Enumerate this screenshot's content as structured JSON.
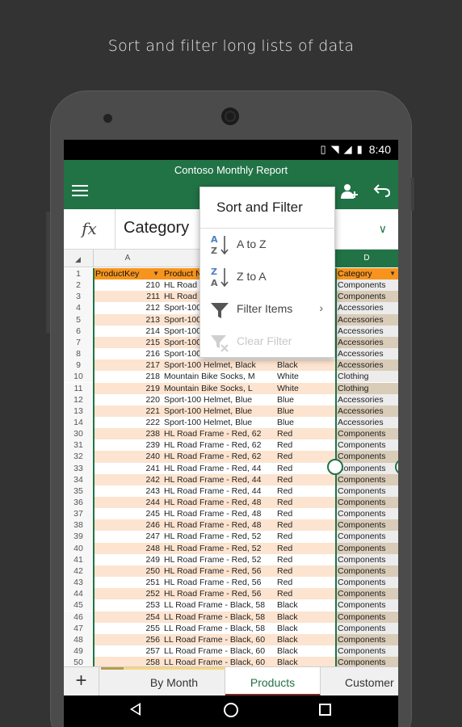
{
  "caption": "Sort and filter long lists of data",
  "status_bar": {
    "time": "8:40"
  },
  "app": {
    "doc_title": "Contoso Monthly Report"
  },
  "formula_bar": {
    "fx": "fx",
    "value": "Category"
  },
  "columns": {
    "a": "A",
    "d": "D"
  },
  "header_row": {
    "num": "1",
    "a": "ProductKey",
    "b": "Product N",
    "c": "",
    "d": "Category"
  },
  "rows": [
    {
      "num": "2",
      "a": "210",
      "b": "HL Road",
      "c": "",
      "d": "Components"
    },
    {
      "num": "3",
      "a": "211",
      "b": "HL Road",
      "c": "",
      "d": "Components"
    },
    {
      "num": "4",
      "a": "212",
      "b": "Sport-100",
      "c": "",
      "d": "Accessories"
    },
    {
      "num": "5",
      "a": "213",
      "b": "Sport-100",
      "c": "",
      "d": "Accessories"
    },
    {
      "num": "6",
      "a": "214",
      "b": "Sport-100",
      "c": "",
      "d": "Accessories"
    },
    {
      "num": "7",
      "a": "215",
      "b": "Sport-100",
      "c": "",
      "d": "Accessories"
    },
    {
      "num": "8",
      "a": "216",
      "b": "Sport-100",
      "c": "",
      "d": "Accessories"
    },
    {
      "num": "9",
      "a": "217",
      "b": "Sport-100 Helmet, Black",
      "c": "Black",
      "d": "Accessories"
    },
    {
      "num": "10",
      "a": "218",
      "b": "Mountain Bike Socks, M",
      "c": "White",
      "d": "Clothing"
    },
    {
      "num": "11",
      "a": "219",
      "b": "Mountain Bike Socks, L",
      "c": "White",
      "d": "Clothing"
    },
    {
      "num": "12",
      "a": "220",
      "b": "Sport-100 Helmet, Blue",
      "c": "Blue",
      "d": "Accessories"
    },
    {
      "num": "13",
      "a": "221",
      "b": "Sport-100 Helmet, Blue",
      "c": "Blue",
      "d": "Accessories"
    },
    {
      "num": "14",
      "a": "222",
      "b": "Sport-100 Helmet, Blue",
      "c": "Blue",
      "d": "Accessories"
    },
    {
      "num": "30",
      "a": "238",
      "b": "HL Road Frame - Red, 62",
      "c": "Red",
      "d": "Components"
    },
    {
      "num": "31",
      "a": "239",
      "b": "HL Road Frame - Red, 62",
      "c": "Red",
      "d": "Components"
    },
    {
      "num": "32",
      "a": "240",
      "b": "HL Road Frame - Red, 62",
      "c": "Red",
      "d": "Components"
    },
    {
      "num": "33",
      "a": "241",
      "b": "HL Road Frame - Red, 44",
      "c": "Red",
      "d": "Components"
    },
    {
      "num": "34",
      "a": "242",
      "b": "HL Road Frame - Red, 44",
      "c": "Red",
      "d": "Components"
    },
    {
      "num": "35",
      "a": "243",
      "b": "HL Road Frame - Red, 44",
      "c": "Red",
      "d": "Components"
    },
    {
      "num": "36",
      "a": "244",
      "b": "HL Road Frame - Red, 48",
      "c": "Red",
      "d": "Components"
    },
    {
      "num": "37",
      "a": "245",
      "b": "HL Road Frame - Red, 48",
      "c": "Red",
      "d": "Components"
    },
    {
      "num": "38",
      "a": "246",
      "b": "HL Road Frame - Red, 48",
      "c": "Red",
      "d": "Components"
    },
    {
      "num": "39",
      "a": "247",
      "b": "HL Road Frame - Red, 52",
      "c": "Red",
      "d": "Components"
    },
    {
      "num": "40",
      "a": "248",
      "b": "HL Road Frame - Red, 52",
      "c": "Red",
      "d": "Components"
    },
    {
      "num": "41",
      "a": "249",
      "b": "HL Road Frame - Red, 52",
      "c": "Red",
      "d": "Components"
    },
    {
      "num": "42",
      "a": "250",
      "b": "HL Road Frame - Red, 56",
      "c": "Red",
      "d": "Components"
    },
    {
      "num": "43",
      "a": "251",
      "b": "HL Road Frame - Red, 56",
      "c": "Red",
      "d": "Components"
    },
    {
      "num": "44",
      "a": "252",
      "b": "HL Road Frame - Red, 56",
      "c": "Red",
      "d": "Components"
    },
    {
      "num": "45",
      "a": "253",
      "b": "LL Road Frame - Black, 58",
      "c": "Black",
      "d": "Components"
    },
    {
      "num": "46",
      "a": "254",
      "b": "LL Road Frame - Black, 58",
      "c": "Black",
      "d": "Components"
    },
    {
      "num": "47",
      "a": "255",
      "b": "LL Road Frame - Black, 58",
      "c": "Black",
      "d": "Components"
    },
    {
      "num": "48",
      "a": "256",
      "b": "LL Road Frame - Black, 60",
      "c": "Black",
      "d": "Components"
    },
    {
      "num": "49",
      "a": "257",
      "b": "LL Road Frame - Black, 60",
      "c": "Black",
      "d": "Components"
    },
    {
      "num": "50",
      "a": "258",
      "b": "LL Road Frame - Black, 60",
      "c": "Black",
      "d": "Components"
    }
  ],
  "popup": {
    "title": "Sort and Filter",
    "items": [
      {
        "label": "A to Z",
        "icon": "sort-a-to-z-icon",
        "icon_text": "A Z"
      },
      {
        "label": "Z to A",
        "icon": "sort-z-to-a-icon",
        "icon_text": "Z A"
      },
      {
        "label": "Filter Items",
        "icon": "filter-icon",
        "icon_text": ""
      },
      {
        "label": "Clear Filter",
        "icon": "clear-filter-icon",
        "icon_text": ""
      }
    ]
  },
  "tabs": {
    "add": "+",
    "items": [
      "By Month",
      "Products",
      "Customer"
    ]
  },
  "colors": {
    "accent": "#217346",
    "header_fill": "#f7941e",
    "band_fill": "#fce4d0"
  }
}
